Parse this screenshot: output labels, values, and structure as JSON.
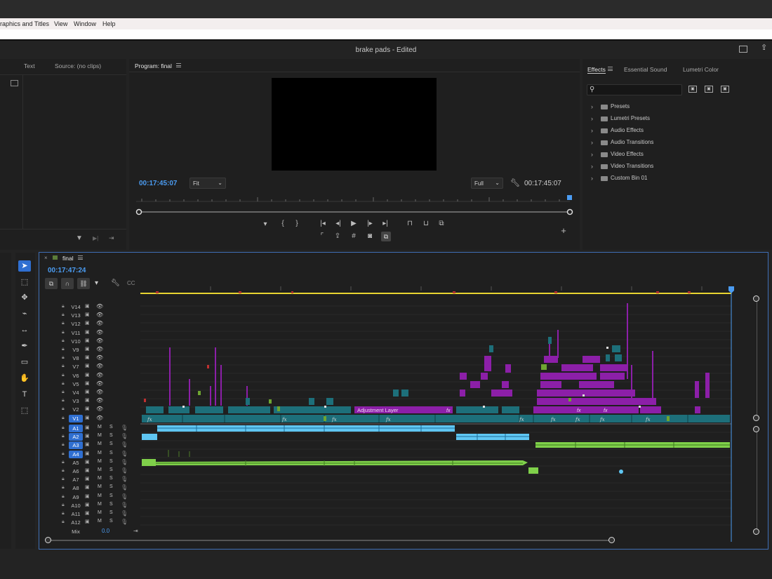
{
  "menu": [
    "raphics and Titles",
    "Window",
    "Help"
  ],
  "document_title": "brake pads - Edited",
  "source_panel": {
    "tabs": [
      "Text",
      "Source: (no clips)"
    ]
  },
  "program_monitor": {
    "tab": "Program: final",
    "timecode_left": "00:17:45:07",
    "timecode_right": "00:17:45:07",
    "fit_value": "Fit",
    "quality_value": "Full"
  },
  "effects_panel": {
    "tabs": [
      "Effects",
      "Essential Sound",
      "Lumetri Color"
    ],
    "search_placeholder": "",
    "items": [
      "Presets",
      "Lumetri Presets",
      "Audio Effects",
      "Audio Transitions",
      "Video Effects",
      "Video Transitions",
      "Custom Bin 01"
    ]
  },
  "timeline": {
    "sequence_name": "final",
    "timecode": "00:17:47:24",
    "video_tracks": [
      "V14",
      "V13",
      "V12",
      "V11",
      "V10",
      "V9",
      "V8",
      "V7",
      "V6",
      "V5",
      "V4",
      "V3",
      "V2",
      "V1"
    ],
    "audio_tracks": [
      "A1",
      "A2",
      "A3",
      "A4",
      "A5",
      "A6",
      "A7",
      "A8",
      "A9",
      "A10",
      "A11",
      "A12"
    ],
    "active_tracks": [
      "V1",
      "A1",
      "A2",
      "A3",
      "A4"
    ],
    "mute_label": "M",
    "solo_label": "S",
    "mix_label": "Mix",
    "mix_value": "0.0",
    "adjustment_layer_label": "Adjustment Layer",
    "fx_label": "fx"
  },
  "colors": {
    "accent_blue": "#4b9cf2",
    "video_clip": "#1d6f7a",
    "adjustment": "#8c1fa8",
    "audio_blue": "#5fc6f2",
    "audio_green": "#7fd04a"
  }
}
